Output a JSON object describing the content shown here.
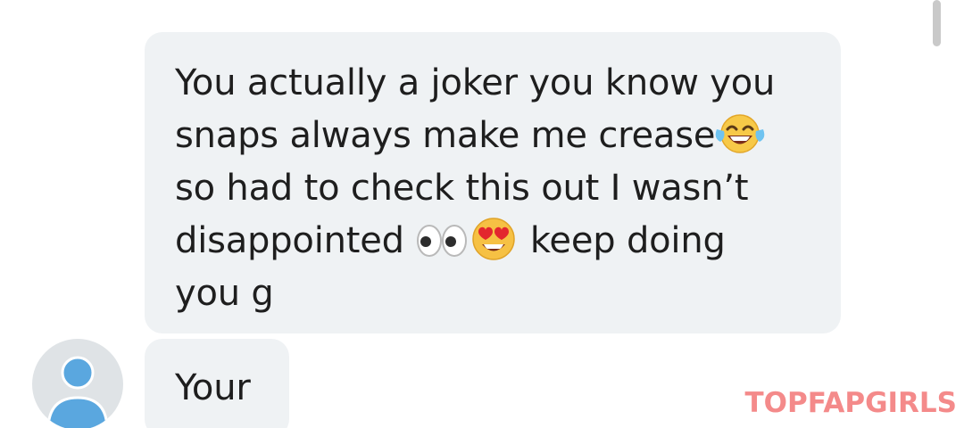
{
  "conversation": {
    "messages": [
      {
        "lines": [
          {
            "text": "You actually a joker you know you",
            "emojis": []
          },
          {
            "text": "snaps always make me crease",
            "emojis": [
              "tears-of-joy"
            ]
          },
          {
            "text": "so had to check this out I wasn’t",
            "emojis": []
          },
          {
            "text": "disappointed ",
            "emojis": [
              "eyes",
              "heart-eyes"
            ],
            "after": " keep doing"
          },
          {
            "text": "you g",
            "emojis": []
          }
        ]
      },
      {
        "lines": [
          {
            "text": "Your"
          }
        ]
      }
    ]
  },
  "avatar": {
    "icon": "user-silhouette-icon",
    "color": "#5aa7df"
  },
  "watermark": {
    "text": "TOPFAPGIRLS",
    "color": "#f48a8a"
  },
  "colors": {
    "bubble": "#eff2f4",
    "text": "#1e1e1e"
  }
}
